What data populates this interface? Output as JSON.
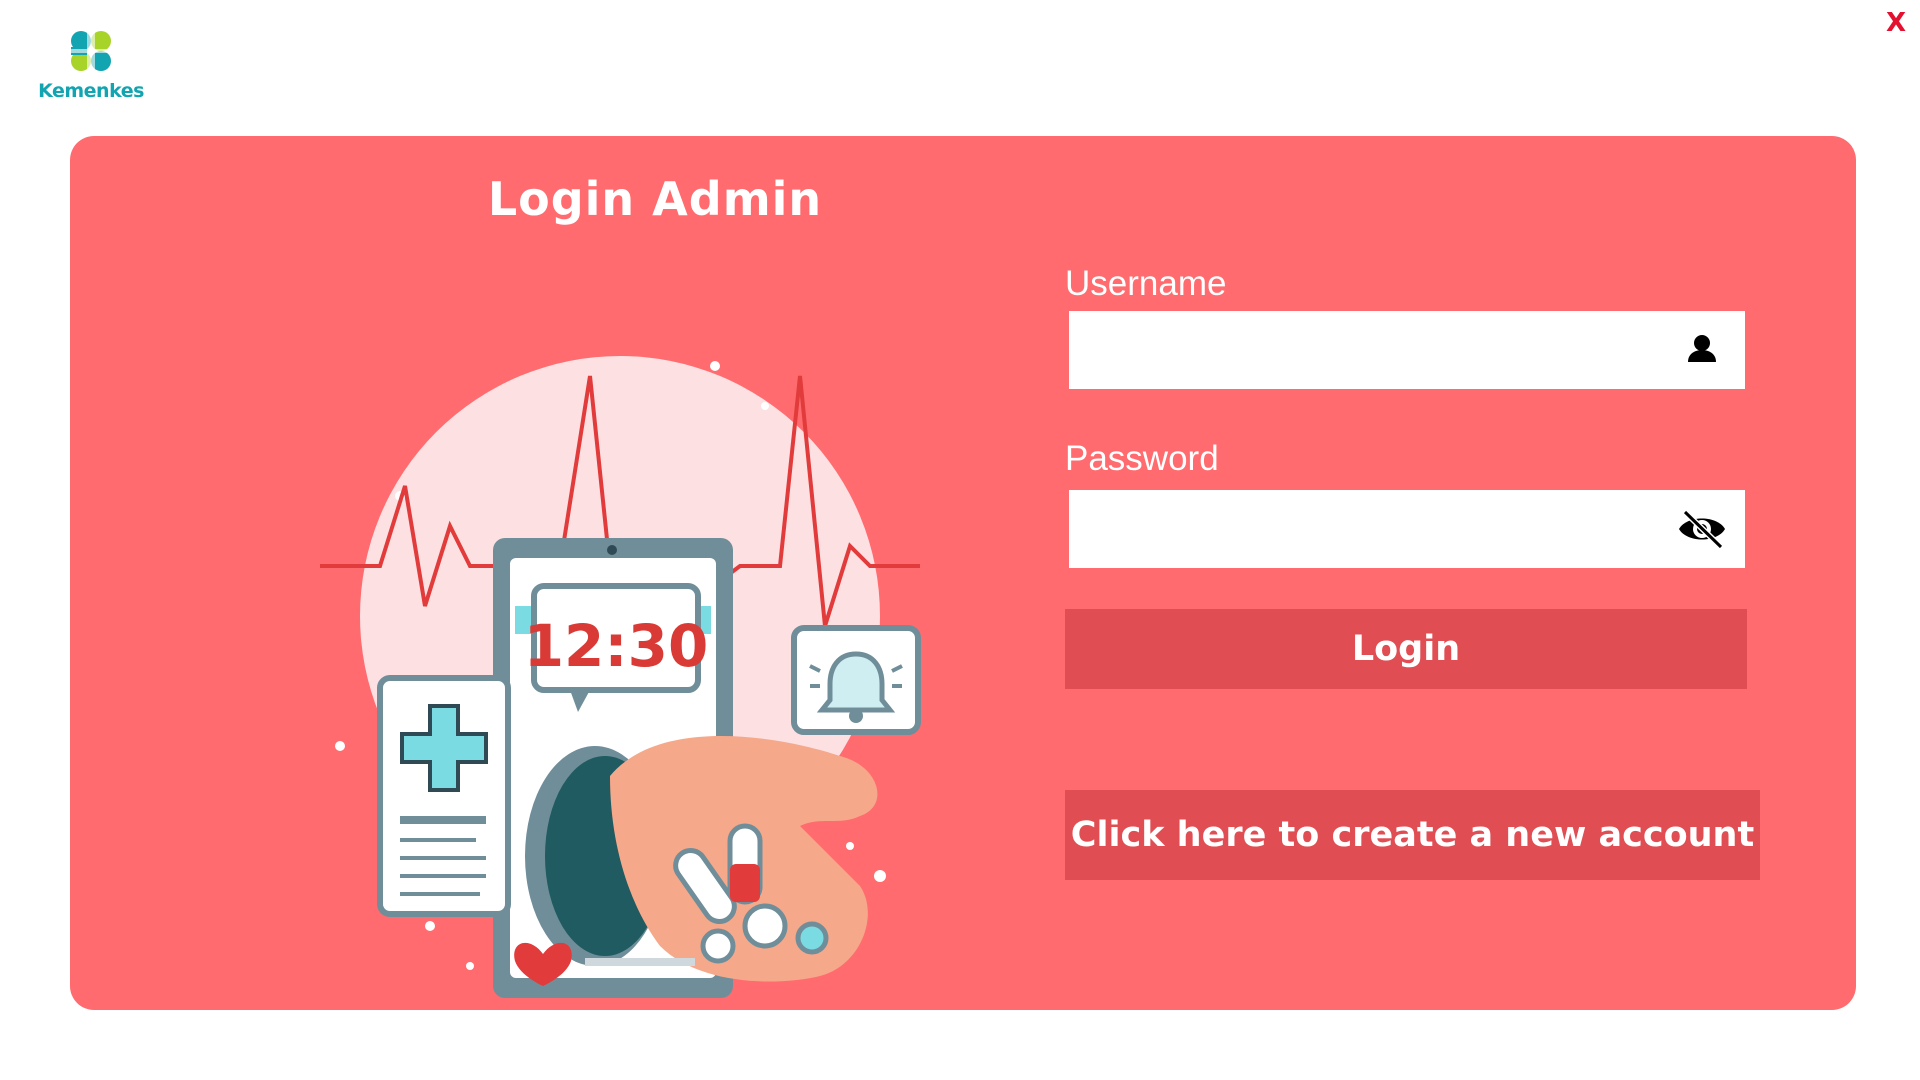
{
  "app": {
    "logo_text": "Kemenkes",
    "close_label": "X"
  },
  "login": {
    "title": "Login Admin",
    "username_label": "Username",
    "username_value": "",
    "password_label": "Password",
    "password_value": "",
    "login_button": "Login",
    "create_account_button": "Click here to create a new account"
  },
  "illustration": {
    "clock_text": "12:30"
  },
  "colors": {
    "card_bg": "#ff6b6e",
    "button_bg": "#e04d53",
    "close": "#e3102f",
    "logo_teal": "#12a4b0",
    "logo_green": "#a8d42a"
  }
}
